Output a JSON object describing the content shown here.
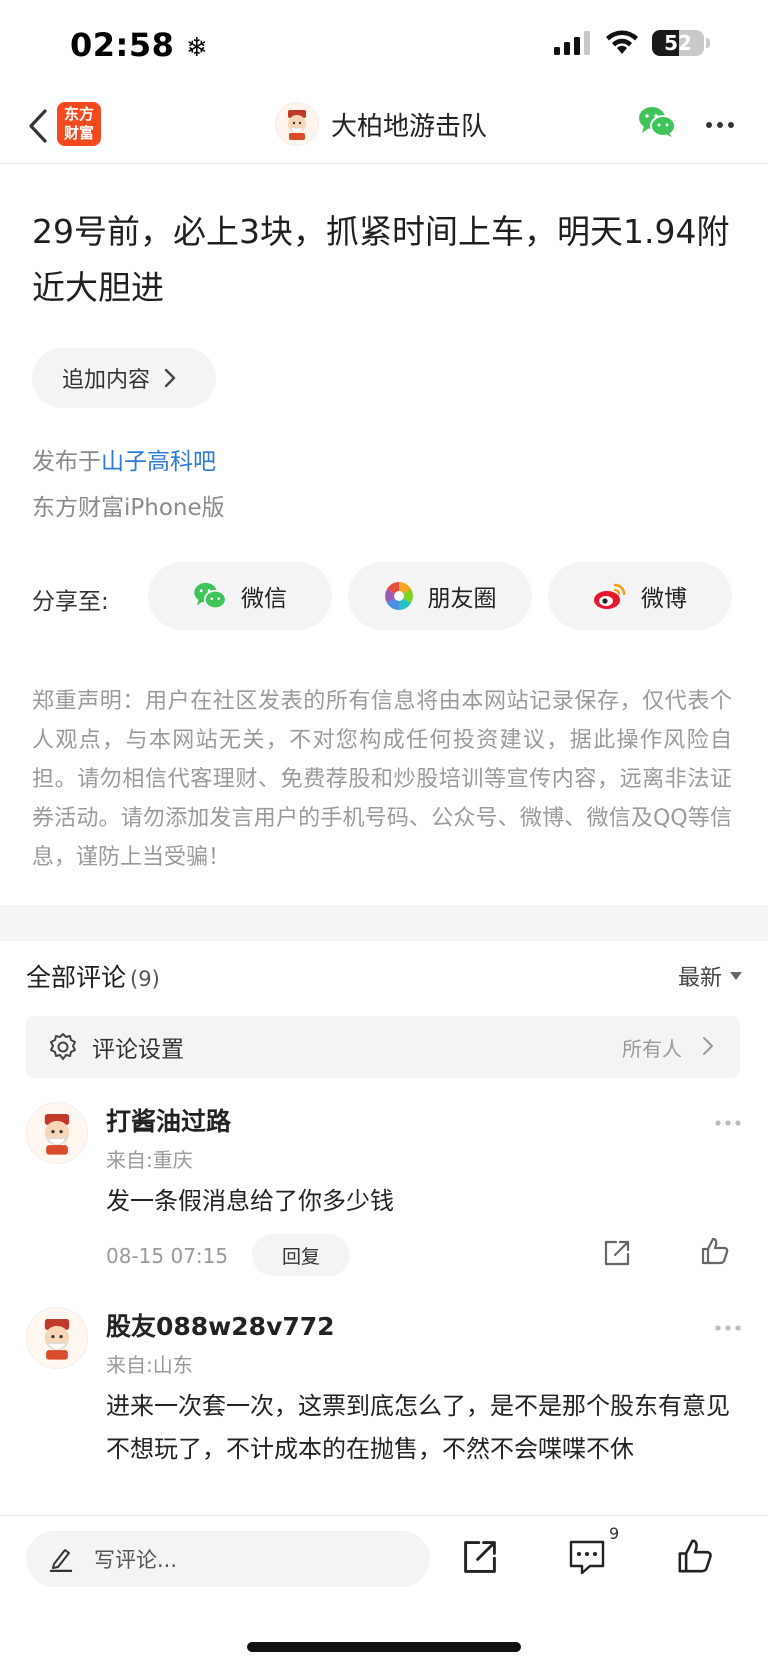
{
  "status_bar": {
    "time": "02:58",
    "battery": "52",
    "battery_level": 0.52
  },
  "nav": {
    "app_logo_line1": "东方",
    "app_logo_line2": "财富",
    "title": "大柏地游击队"
  },
  "post": {
    "title": "29号前，必上3块，抓紧时间上车，明天1.94附近大胆进",
    "add_content_label": "追加内容",
    "published_prefix": "发布于",
    "board_name": "山子高科吧",
    "source": "东方财富iPhone版"
  },
  "share": {
    "label": "分享至:",
    "wechat": "微信",
    "moments": "朋友圈",
    "weibo": "微博"
  },
  "disclaimer": "郑重声明：用户在社区发表的所有信息将由本网站记录保存，仅代表个人观点，与本网站无关，不对您构成任何投资建议，据此操作风险自担。请勿相信代客理财、免费荐股和炒股培训等宣传内容，远离非法证券活动。请勿添加发言用户的手机号码、公众号、微博、微信及QQ等信息，谨防上当受骗！",
  "comments": {
    "title": "全部评论",
    "count": "(9)",
    "sort": "最新",
    "settings_label": "评论设置",
    "settings_value": "所有人",
    "items": [
      {
        "name": "打酱油过路",
        "location": "来自:重庆",
        "text": "发一条假消息给了你多少钱",
        "time": "08-15 07:15",
        "reply": "回复"
      },
      {
        "name": "股友088w28v772",
        "location": "来自:山东",
        "text": "进来一次套一次，这票到底怎么了，是不是那个股东有意见不想玩了，不计成本的在抛售，不然不会喋喋不休"
      }
    ]
  },
  "bottom_bar": {
    "input_placeholder": "写评论...",
    "comment_badge": "9"
  },
  "colors": {
    "brand": "#f04a1e",
    "link": "#2b7ad8",
    "wechat_green": "#3fc45a",
    "weibo_red": "#e6162d"
  }
}
